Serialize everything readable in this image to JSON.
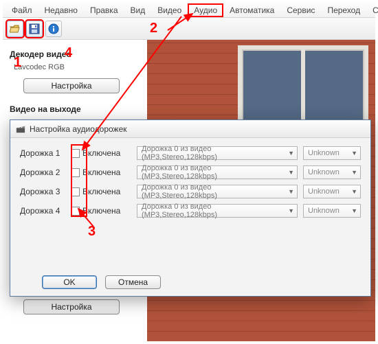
{
  "menu": {
    "items": [
      "Файл",
      "Недавно",
      "Правка",
      "Вид",
      "Видео",
      "Аудио",
      "Автоматика",
      "Сервис",
      "Переход",
      "Своё"
    ],
    "highlight_index": 5
  },
  "toolbar": {
    "open_icon": "open-icon",
    "save_icon": "save-icon",
    "info_icon": "info-icon"
  },
  "side": {
    "decoder_title": "Декодер видео",
    "decoder_sub": "Lavcodec      RGB",
    "settings_label": "Настройка",
    "output_title": "Видео на выходе",
    "settings_label2": "Настройка"
  },
  "dialog": {
    "title": "Настройка аудиодорожек",
    "tracks": [
      {
        "label": "Дорожка 1",
        "enabled_label": "Включена",
        "source": "Дорожка 0 из видео (MP3,Stereo,128kbps)",
        "encoder": "Unknown"
      },
      {
        "label": "Дорожка 2",
        "enabled_label": "Включена",
        "source": "Дорожка 0 из видео (MP3,Stereo,128kbps)",
        "encoder": "Unknown"
      },
      {
        "label": "Дорожка 3",
        "enabled_label": "Включена",
        "source": "Дорожка 0 из видео (MP3,Stereo,128kbps)",
        "encoder": "Unknown"
      },
      {
        "label": "Дорожка 4",
        "enabled_label": "Включена",
        "source": "Дорожка 0 из видео (MP3,Stereo,128kbps)",
        "encoder": "Unknown"
      }
    ],
    "ok_label": "OK",
    "cancel_label": "Отмена"
  },
  "annotations": {
    "n1": "1",
    "n2": "2",
    "n3": "3",
    "n4": "4",
    "color": "#ff0000"
  }
}
